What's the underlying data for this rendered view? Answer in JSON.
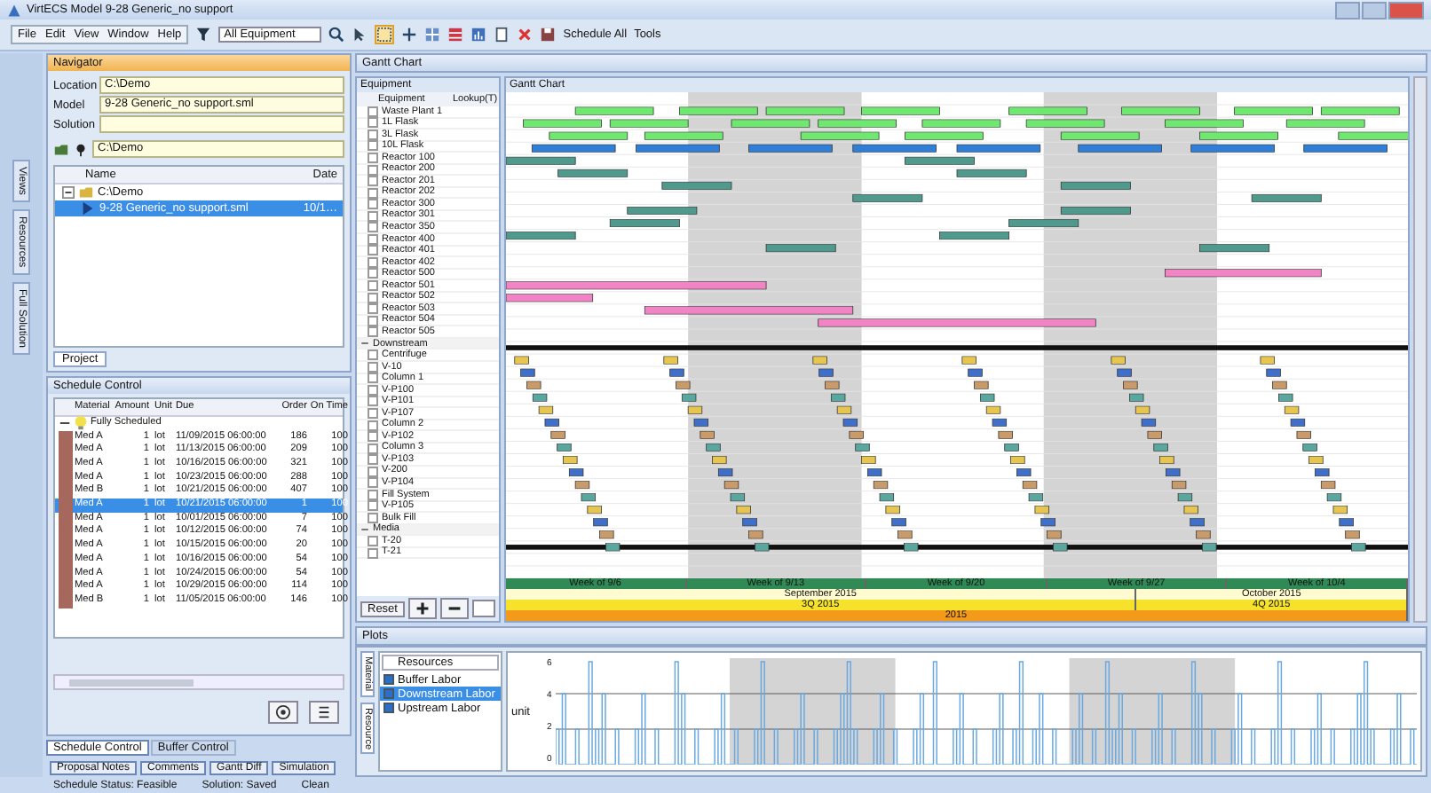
{
  "window": {
    "title": "VirtECS Model 9-28 Generic_no support"
  },
  "menu": [
    {
      "label": "File"
    },
    {
      "label": "Edit"
    },
    {
      "label": "View"
    },
    {
      "label": "Window"
    },
    {
      "label": "Help"
    }
  ],
  "toolbar": {
    "filter": "All Equipment",
    "menus": [
      "Schedule All",
      "Tools"
    ]
  },
  "side_tabs": [
    "Views",
    "Resources",
    "Full Solution"
  ],
  "navigator": {
    "title": "Navigator",
    "fields": [
      {
        "label": "Location",
        "value": "C:\\Demo"
      },
      {
        "label": "Model",
        "value": "9-28 Generic_no support.sml"
      },
      {
        "label": "Solution"
      }
    ],
    "folder": "C:\\Demo",
    "columns": [
      "Name",
      "Date"
    ],
    "tree": [
      {
        "name": "C:\\Demo",
        "expanded": true,
        "children": [
          {
            "name": "9-28 Generic_no support.sml",
            "date": "10/1…",
            "selected": true
          }
        ]
      }
    ],
    "tab": "Project"
  },
  "schedule_control": {
    "title": "Schedule Control",
    "columns": [
      "Material",
      "Amount",
      "Unit",
      "Due",
      "Order",
      "On Time"
    ],
    "group": {
      "label": "Fully Scheduled",
      "expanded": true
    },
    "rows": [
      {
        "material": "Med A",
        "amount": "1",
        "unit": "lot",
        "due": "11/09/2015 06:00:00",
        "order": "186",
        "on_time": "100",
        "selected": false
      },
      {
        "material": "Med A",
        "amount": "1",
        "unit": "lot",
        "due": "11/13/2015 06:00:00",
        "order": "209",
        "on_time": "100",
        "selected": false
      },
      {
        "material": "Med A",
        "amount": "1",
        "unit": "lot",
        "due": "10/16/2015 06:00:00",
        "order": "321",
        "on_time": "100",
        "selected": false
      },
      {
        "material": "Med A",
        "amount": "1",
        "unit": "lot",
        "due": "10/23/2015 06:00:00",
        "order": "288",
        "on_time": "100",
        "selected": false
      },
      {
        "material": "Med B",
        "amount": "1",
        "unit": "lot",
        "due": "10/21/2015 06:00:00",
        "order": "407",
        "on_time": "100",
        "selected": false
      },
      {
        "material": "Med A",
        "amount": "1",
        "unit": "lot",
        "due": "10/21/2015 06:00:00",
        "order": "1",
        "on_time": "100",
        "selected": true
      },
      {
        "material": "Med A",
        "amount": "1",
        "unit": "lot",
        "due": "10/01/2015 06:00:00",
        "order": "7",
        "on_time": "100",
        "selected": false
      },
      {
        "material": "Med A",
        "amount": "1",
        "unit": "lot",
        "due": "10/12/2015 06:00:00",
        "order": "74",
        "on_time": "100",
        "selected": false
      },
      {
        "material": "Med A",
        "amount": "1",
        "unit": "lot",
        "due": "10/15/2015 06:00:00",
        "order": "20",
        "on_time": "100",
        "selected": false
      },
      {
        "material": "Med A",
        "amount": "1",
        "unit": "lot",
        "due": "10/16/2015 06:00:00",
        "order": "54",
        "on_time": "100",
        "selected": false
      },
      {
        "material": "Med A",
        "amount": "1",
        "unit": "lot",
        "due": "10/24/2015 06:00:00",
        "order": "54",
        "on_time": "100",
        "selected": false
      },
      {
        "material": "Med A",
        "amount": "1",
        "unit": "lot",
        "due": "10/29/2015 06:00:00",
        "order": "114",
        "on_time": "100",
        "selected": false
      },
      {
        "material": "Med B",
        "amount": "1",
        "unit": "lot",
        "due": "11/05/2015 06:00:00",
        "order": "146",
        "on_time": "100",
        "selected": false
      }
    ]
  },
  "bottom_tabs": [
    {
      "label": "Schedule Control",
      "selected": true
    },
    {
      "label": "Buffer Control",
      "selected": false
    }
  ],
  "lower_tabs": [
    "Proposal Notes",
    "Comments",
    "Gantt Diff",
    "Simulation"
  ],
  "status_bar": [
    "Schedule Status: Feasible",
    "Solution: Saved",
    "Clean"
  ],
  "gantt": {
    "pane_title": "Gantt Chart",
    "list_title": "Equipment",
    "chart_title": "Gantt Chart",
    "columns": [
      "Equipment",
      "Lookup(T)"
    ],
    "groups": [
      {
        "items": [
          {
            "name": "Waste Plant 1",
            "checked": false
          },
          {
            "name": "1L Flask",
            "checked": false
          },
          {
            "name": "3L Flask",
            "checked": false
          },
          {
            "name": "10L Flask",
            "checked": false
          },
          {
            "name": "Reactor 100",
            "checked": false
          },
          {
            "name": "Reactor 200",
            "checked": false
          },
          {
            "name": "Reactor 201",
            "checked": false
          },
          {
            "name": "Reactor 202",
            "checked": false
          },
          {
            "name": "Reactor 300",
            "checked": false
          },
          {
            "name": "Reactor 301",
            "checked": false
          },
          {
            "name": "Reactor 350",
            "checked": false
          },
          {
            "name": "Reactor 400",
            "checked": false
          },
          {
            "name": "Reactor 401",
            "checked": false
          },
          {
            "name": "Reactor 402",
            "checked": false
          },
          {
            "name": "Reactor 500",
            "checked": false
          },
          {
            "name": "Reactor 501",
            "checked": false
          },
          {
            "name": "Reactor 502",
            "checked": false
          },
          {
            "name": "Reactor 503",
            "checked": false
          },
          {
            "name": "Reactor 504",
            "checked": false
          },
          {
            "name": "Reactor 505",
            "checked": false
          }
        ]
      },
      {
        "name": "Downstream",
        "expanded": true,
        "items": [
          {
            "name": "Centrifuge",
            "checked": false
          },
          {
            "name": "V-10",
            "checked": false
          },
          {
            "name": "Column 1",
            "checked": false
          },
          {
            "name": "V-P100",
            "checked": false
          },
          {
            "name": "V-P101",
            "checked": false
          },
          {
            "name": "V-P107",
            "checked": false
          },
          {
            "name": "Column 2",
            "checked": false
          },
          {
            "name": "V-P102",
            "checked": false
          },
          {
            "name": "Column 3",
            "checked": false
          },
          {
            "name": "V-P103",
            "checked": false
          },
          {
            "name": "V-200",
            "checked": false
          },
          {
            "name": "V-P104",
            "checked": false
          },
          {
            "name": "Fill System",
            "checked": false
          },
          {
            "name": "V-P105",
            "checked": false
          },
          {
            "name": "Bulk Fill",
            "checked": false
          }
        ]
      },
      {
        "name": "Media",
        "expanded": true,
        "items": [
          {
            "name": "T-20",
            "checked": false
          },
          {
            "name": "T-21",
            "checked": false
          }
        ]
      }
    ],
    "reset": "Reset",
    "timeline": {
      "weeks": [
        "Week of 9/6",
        "Week of 9/13",
        "Week of 9/20",
        "Week of 9/27",
        "Week of 10/4"
      ],
      "months": [
        "September 2015",
        "October 2015"
      ],
      "quarters": [
        "3Q 2015",
        "4Q 2015"
      ],
      "years": [
        "2015"
      ]
    }
  },
  "plots": {
    "title": "Plots",
    "tabs": [
      "Material",
      "Resource"
    ],
    "dropdown": "Resources",
    "ylabel": "unit",
    "yticks": [
      "6",
      "4",
      "2",
      "0"
    ],
    "series": [
      {
        "name": "Buffer Labor",
        "checked": true,
        "selected": false
      },
      {
        "name": "Downstream Labor",
        "checked": true,
        "selected": true
      },
      {
        "name": "Upstream Labor",
        "checked": true,
        "selected": false
      }
    ]
  }
}
